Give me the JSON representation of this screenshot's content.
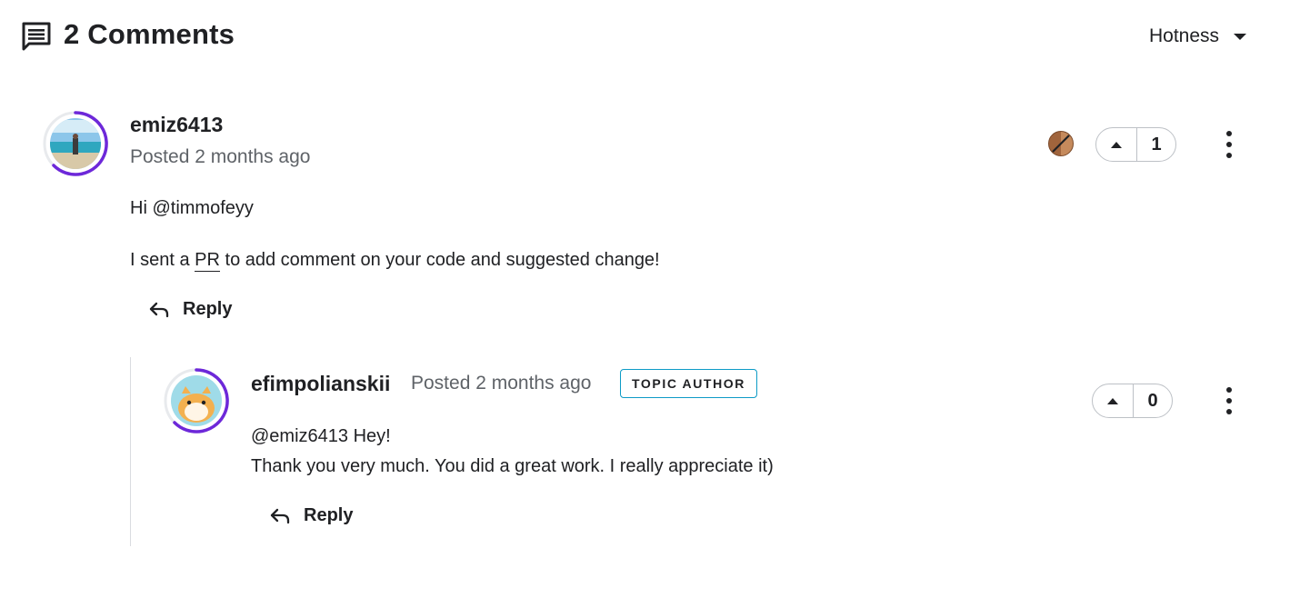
{
  "header": {
    "comments_title": "2 Comments",
    "sort_label": "Hotness",
    "icons": {
      "comments": "comment-lines-icon",
      "sort": "caret-down-icon"
    }
  },
  "comments": [
    {
      "username": "emiz6413",
      "posted": "Posted 2 months ago",
      "tier_icon": "bronze-medal-icon",
      "votes": "1",
      "body": {
        "greeting": "Hi ",
        "mention": "@timmofeyy",
        "line2_before": "I sent a ",
        "line2_link": "PR",
        "line2_after": " to add comment on your code and suggested change!"
      },
      "reply_label": "Reply"
    },
    {
      "username": "efimpolianskii",
      "posted": "Posted 2 months ago",
      "badge": "TOPIC AUTHOR",
      "votes": "0",
      "body": {
        "mention": "@emiz6413",
        "line1_after": " Hey!",
        "line2": "Thank you very much. You did a great work. I really appreciate it)"
      },
      "reply_label": "Reply"
    }
  ],
  "colors": {
    "avatar_ring": "#6d28d9",
    "badge_border": "#0d9bc6",
    "medal": "#a0643c",
    "text": "#202124",
    "muted": "#5f6368"
  }
}
